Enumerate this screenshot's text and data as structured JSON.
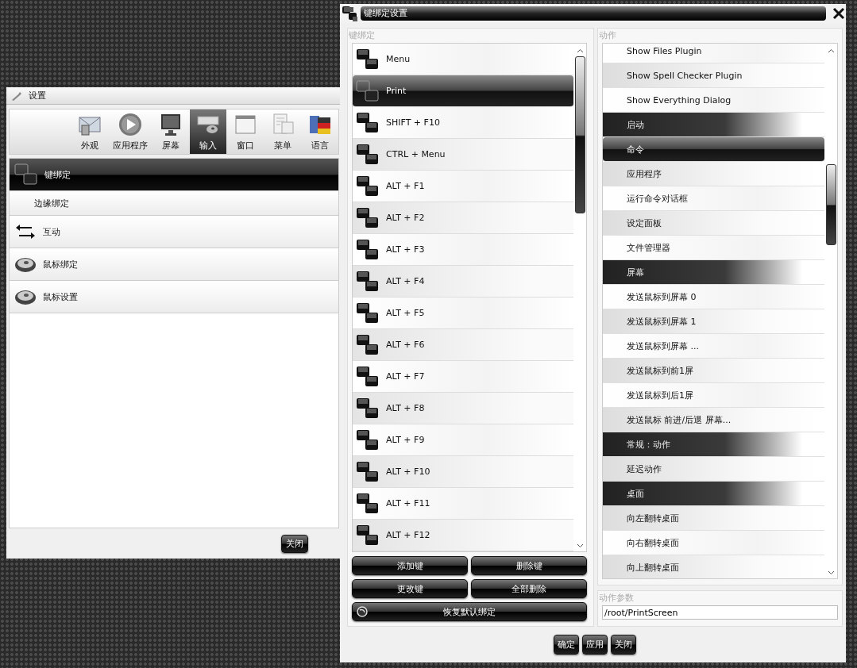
{
  "settings_window": {
    "title": "设置",
    "toolbar": [
      {
        "label": "外观",
        "selected": false
      },
      {
        "label": "应用程序",
        "selected": false
      },
      {
        "label": "屏幕",
        "selected": false
      },
      {
        "label": "输入",
        "selected": true
      },
      {
        "label": "窗口",
        "selected": false
      },
      {
        "label": "菜单",
        "selected": false
      },
      {
        "label": "语言",
        "selected": false
      }
    ],
    "sidebar": {
      "items": [
        {
          "label": "键绑定",
          "kind": "keys",
          "selected": true,
          "children": [
            {
              "label": "边缘绑定",
              "selected": false
            }
          ]
        },
        {
          "label": "互动",
          "kind": "arrows",
          "selected": false
        },
        {
          "label": "鼠标绑定",
          "kind": "mouse",
          "selected": false
        },
        {
          "label": "鼠标设置",
          "kind": "mouse",
          "selected": false
        }
      ]
    },
    "buttons": [
      "关闭"
    ]
  },
  "keybind_window": {
    "title": "键绑定设置",
    "bindings": {
      "label": "键绑定",
      "items": [
        {
          "label": "Menu",
          "selected": false
        },
        {
          "label": "Print",
          "selected": true
        },
        {
          "label": "SHIFT + F10",
          "selected": false
        },
        {
          "label": "CTRL + Menu",
          "selected": false
        },
        {
          "label": "ALT + F1",
          "selected": false
        },
        {
          "label": "ALT + F2",
          "selected": false
        },
        {
          "label": "ALT + F3",
          "selected": false
        },
        {
          "label": "ALT + F4",
          "selected": false
        },
        {
          "label": "ALT + F5",
          "selected": false
        },
        {
          "label": "ALT + F6",
          "selected": false
        },
        {
          "label": "ALT + F7",
          "selected": false
        },
        {
          "label": "ALT + F8",
          "selected": false
        },
        {
          "label": "ALT + F9",
          "selected": false
        },
        {
          "label": "ALT + F10",
          "selected": false
        },
        {
          "label": "ALT + F11",
          "selected": false
        },
        {
          "label": "ALT + F12",
          "selected": false
        }
      ],
      "buttons": [
        {
          "label": "添加键",
          "kind": "plain"
        },
        {
          "label": "删除键",
          "kind": "plain"
        },
        {
          "label": "更改键",
          "kind": "plain"
        },
        {
          "label": "全部删除",
          "kind": "plain"
        },
        {
          "label": "恢复默认绑定",
          "kind": "restore"
        }
      ]
    },
    "actions": {
      "label": "动作",
      "items": [
        {
          "label": "Show Files Plugin",
          "kind": "action",
          "selected": false
        },
        {
          "label": "Show Spell Checker Plugin",
          "kind": "action",
          "selected": false
        },
        {
          "label": "Show Everything Dialog",
          "kind": "action",
          "selected": false
        },
        {
          "label": "启动",
          "kind": "header",
          "selected": false
        },
        {
          "label": "命令",
          "kind": "action",
          "selected": true
        },
        {
          "label": "应用程序",
          "kind": "action",
          "selected": false
        },
        {
          "label": "运行命令对话框",
          "kind": "action",
          "selected": false
        },
        {
          "label": "设定面板",
          "kind": "action",
          "selected": false
        },
        {
          "label": "文件管理器",
          "kind": "action",
          "selected": false
        },
        {
          "label": "屏幕",
          "kind": "header",
          "selected": false
        },
        {
          "label": "发送鼠标到屏幕 0",
          "kind": "action",
          "selected": false
        },
        {
          "label": "发送鼠标到屏幕 1",
          "kind": "action",
          "selected": false
        },
        {
          "label": "发送鼠标到屏幕 ...",
          "kind": "action",
          "selected": false
        },
        {
          "label": "发送鼠标到前1屏",
          "kind": "action",
          "selected": false
        },
        {
          "label": "发送鼠标到后1屏",
          "kind": "action",
          "selected": false
        },
        {
          "label": "发送鼠标 前进/后退 屏幕...",
          "kind": "action",
          "selected": false
        },
        {
          "label": "常规：动作",
          "kind": "header",
          "selected": false
        },
        {
          "label": "延迟动作",
          "kind": "action",
          "selected": false
        },
        {
          "label": "桌面",
          "kind": "header",
          "selected": false
        },
        {
          "label": "向左翻转桌面",
          "kind": "action",
          "selected": false
        },
        {
          "label": "向右翻转桌面",
          "kind": "action",
          "selected": false
        },
        {
          "label": "向上翻转桌面",
          "kind": "action",
          "selected": false
        }
      ]
    },
    "params": {
      "label": "动作参数",
      "value": "/root/PrintScreen"
    },
    "buttons": [
      "确定",
      "应用",
      "关闭"
    ]
  }
}
